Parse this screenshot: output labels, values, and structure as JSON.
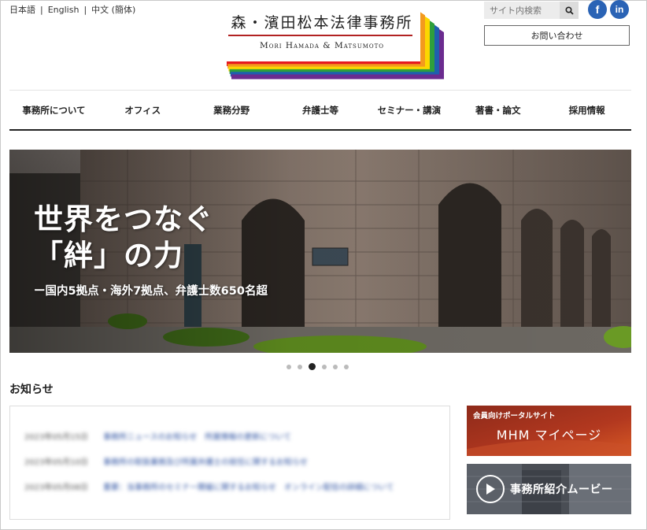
{
  "header": {
    "languages": [
      "日本語",
      "English",
      "中文 (簡体)"
    ],
    "logo": {
      "name_jp": "森・濱田松本法律事務所",
      "name_en": "Mori Hamada & Matsumoto",
      "stripe_colors": [
        "#e6191f",
        "#f39a1e",
        "#fcd700",
        "#2e9f3b",
        "#1f5fae",
        "#6b2b8f"
      ]
    },
    "search": {
      "placeholder": "サイト内検索"
    },
    "social": {
      "facebook": "f",
      "linkedin": "in"
    },
    "contact_label": "お問い合わせ"
  },
  "nav": {
    "items": [
      "事務所について",
      "オフィス",
      "業務分野",
      "弁護士等",
      "セミナー・講演",
      "著書・論文",
      "採用情報"
    ]
  },
  "hero": {
    "title_line1": "世界をつなぐ",
    "title_line2": "「絆」の力",
    "subtitle": "ー国内5拠点・海外7拠点、弁護士数650名超"
  },
  "carousel": {
    "count": 6,
    "active_index": 2
  },
  "news": {
    "heading": "お知らせ",
    "items": [
      {
        "date": "2023年05月15日",
        "title": "事務所ニュースのお知らせ　所属情報の更新について"
      },
      {
        "date": "2023年05月10日",
        "title": "事務所の取扱業務及び所属弁護士の就任に関するお知らせ"
      },
      {
        "date": "2023年05月08日",
        "title": "重要：当事務所のセミナー開催に関するお知らせ　オンライン配信の詳細について"
      }
    ]
  },
  "banners": {
    "portal_small": "会員向けポータルサイト",
    "portal_big": "MHM マイページ",
    "movie": "事務所紹介ムービー"
  }
}
